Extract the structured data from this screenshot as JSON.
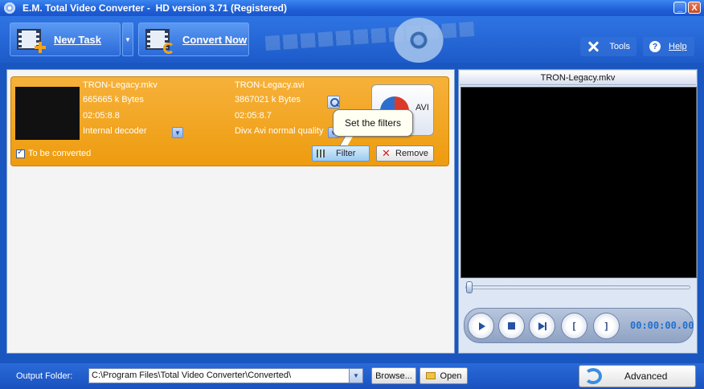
{
  "window": {
    "title": "E.M. Total Video Converter -  HD version 3.71 (Registered)",
    "minimize": "_",
    "close": "X"
  },
  "toolbar": {
    "new_task": "New Task",
    "convert_now": "Convert Now",
    "tools": "Tools",
    "help": "Help"
  },
  "task": {
    "source_name": "TRON-Legacy.mkv",
    "source_size": "665665 k Bytes",
    "source_duration": "02:05:8.8",
    "decoder": "Internal decoder",
    "target_name": "TRON-Legacy.avi",
    "target_size": "3867021 k Bytes",
    "target_duration": "02:05:8.7",
    "target_profile": "Divx Avi normal quality",
    "format_label": "AVI",
    "checkbox_label": "To be converted",
    "filter_label": "Filter",
    "remove_label": "Remove",
    "tooltip": "Set the filters"
  },
  "preview": {
    "title": "TRON-Legacy.mkv",
    "timecode": "00:00:00.00",
    "mark_in": "[",
    "mark_out": "]"
  },
  "bottom": {
    "output_folder_label": "Output Folder:",
    "output_folder_value": "C:\\Program Files\\Total Video Converter\\Converted\\",
    "browse": "Browse...",
    "open": "Open",
    "advanced": "Advanced"
  },
  "colors": {
    "accent": "#1d5bc9",
    "task_row": "#f2a624",
    "timecode": "#1f6fd0"
  },
  "icons": [
    "app-icon",
    "new-task-icon",
    "convert-now-icon",
    "tools-icon",
    "help-icon",
    "search-icon",
    "chevron-down-icon",
    "avi-format-icon",
    "filter-icon",
    "close-icon",
    "play-icon",
    "stop-icon",
    "next-frame-icon",
    "folder-icon",
    "advanced-icon"
  ]
}
